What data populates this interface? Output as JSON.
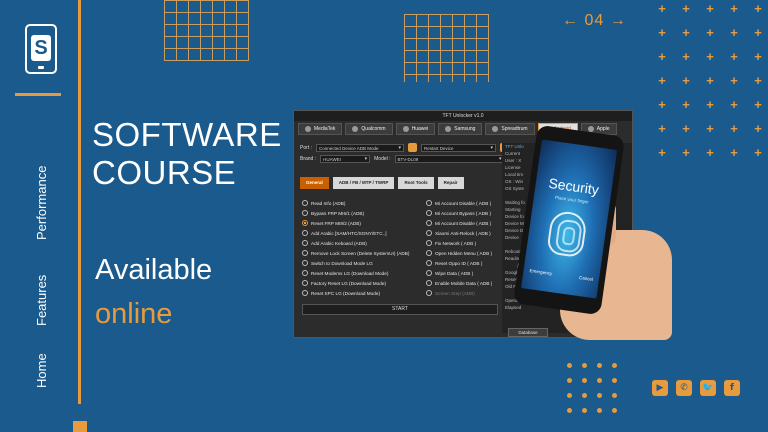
{
  "sidebar": {
    "logo_letter": "S",
    "nav": [
      {
        "label": "Performance"
      },
      {
        "label": "Features"
      },
      {
        "label": "Home"
      }
    ]
  },
  "hero": {
    "title_line1": "SOFTWARE",
    "title_line2": "COURSE",
    "available": "Available",
    "online": "online"
  },
  "pager": {
    "label": "04",
    "prev_glyph": "←",
    "next_glyph": "→"
  },
  "app": {
    "title": "TFT Unlocker v1.0",
    "brands": [
      {
        "label": "MediaTek"
      },
      {
        "label": "Qualcomm"
      },
      {
        "label": "Huawei"
      },
      {
        "label": "Samsung"
      },
      {
        "label": "Spreadtrum"
      },
      {
        "label": "Android",
        "active": true
      },
      {
        "label": "Apple"
      }
    ],
    "port_label": "Port :",
    "port_value": "Connected Device ADB Mode",
    "restart_value": "Restart Device",
    "brand_label": "Brand :",
    "brand_value": "HUAWEI",
    "model_label": "Model :",
    "model_value": "BTV-DL09",
    "tabs": [
      {
        "label": "General",
        "active": true
      },
      {
        "label": "ADB / FB / MTP / TWRP"
      },
      {
        "label": "Root Tools"
      },
      {
        "label": "Repair"
      }
    ],
    "ops_left": [
      {
        "label": "Read Info (ADB)"
      },
      {
        "label": "Bypass FRP MI6/1 (ADB)"
      },
      {
        "label": "Reset FRP MI8/2 (ADB)",
        "checked": true
      },
      {
        "label": "Add Arabic [SAM/HTC/SONY/ETC..]"
      },
      {
        "label": "Add Arabic Keboard (ADB)"
      },
      {
        "label": "Remove Lock Screen (Delete SystemUI) (ADB)"
      },
      {
        "label": "Switch to Download Mode LG"
      },
      {
        "label": "Reset Modems LG (Download Mode)"
      },
      {
        "label": "Factory Reset LG (Download Mode)"
      },
      {
        "label": "Reset SPC LG (Download Mode)"
      }
    ],
    "ops_right": [
      {
        "label": "Mi Account Disable ( ADB )"
      },
      {
        "label": "Mi Account Bypass ( ADB )"
      },
      {
        "label": "Mi Account Disable ( ADB )"
      },
      {
        "label": "Xiaomi Anti-Relock ( ADB )"
      },
      {
        "label": "Fix Network ( ADB )"
      },
      {
        "label": "Open Hidden Menu ( ADB )"
      },
      {
        "label": "Reset Oppo ID ( ADB )"
      },
      {
        "label": "Wipe Data ( ADB )"
      },
      {
        "label": "Enable Mobile Data ( ADB )"
      },
      {
        "label": "Screen Step (ADB)",
        "disabled": true
      }
    ],
    "start_label": "START",
    "log_lines": [
      {
        "text": "TFT Unlo",
        "hl": true
      },
      {
        "text": "Current"
      },
      {
        "text": "User : X"
      },
      {
        "text": "License"
      },
      {
        "text": "Local tim"
      },
      {
        "text": "OS : Win"
      },
      {
        "text": "OS Syste"
      },
      {
        "text": ""
      },
      {
        "text": "Waiting fo"
      },
      {
        "text": "Starting"
      },
      {
        "text": "Device fo"
      },
      {
        "text": "Device M"
      },
      {
        "text": "Device De"
      },
      {
        "text": "Device"
      },
      {
        "text": ""
      },
      {
        "text": "Rebooting"
      },
      {
        "text": "Reading"
      },
      {
        "text": ""
      },
      {
        "text": "Google"
      },
      {
        "text": "Resetting"
      },
      {
        "text": "Old FRP"
      },
      {
        "text": ""
      },
      {
        "text": "Operation"
      },
      {
        "text": "Elapsed"
      }
    ],
    "database_label": "Database"
  },
  "phone": {
    "title": "Security",
    "subtitle": "Place your finger",
    "left_action": "Emergency",
    "right_action": "Cancel"
  },
  "social": [
    {
      "icon": "youtube-icon",
      "glyph": "▶"
    },
    {
      "icon": "whatsapp-icon",
      "glyph": "✆"
    },
    {
      "icon": "twitter-icon",
      "glyph": "🐦"
    },
    {
      "icon": "facebook-icon",
      "glyph": "f"
    }
  ],
  "colors": {
    "background": "#1b5a8c",
    "accent": "#e79b3c"
  }
}
